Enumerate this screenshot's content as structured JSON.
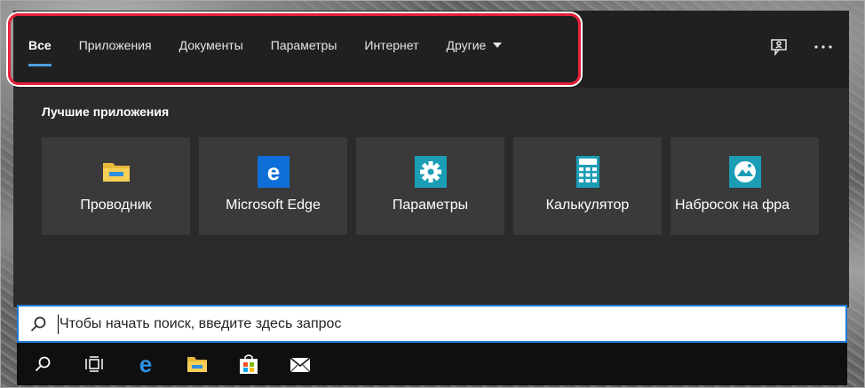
{
  "tabs": [
    {
      "label": "Все",
      "active": true
    },
    {
      "label": "Приложения",
      "active": false
    },
    {
      "label": "Документы",
      "active": false
    },
    {
      "label": "Параметры",
      "active": false
    },
    {
      "label": "Интернет",
      "active": false
    },
    {
      "label": "Другие",
      "active": false,
      "dropdown": true
    }
  ],
  "header_actions": {
    "feedback_icon": "feedback-icon",
    "more_icon": "more-options-icon"
  },
  "best_apps": {
    "title": "Лучшие приложения",
    "items": [
      {
        "label": "Проводник",
        "icon": "file-explorer-icon"
      },
      {
        "label": "Microsoft Edge",
        "icon": "edge-icon"
      },
      {
        "label": "Параметры",
        "icon": "settings-gear-icon"
      },
      {
        "label": "Калькулятор",
        "icon": "calculator-icon"
      },
      {
        "label": "Набросок на фра",
        "icon": "snip-sketch-icon"
      }
    ]
  },
  "search": {
    "placeholder": "Чтобы начать поиск, введите здесь запрос",
    "value": ""
  },
  "taskbar": {
    "items": [
      "search-icon",
      "task-view-icon",
      "edge-icon",
      "file-explorer-icon",
      "store-icon",
      "mail-icon"
    ]
  },
  "colors": {
    "accent": "#4f9fe3",
    "highlight": "#e8203a",
    "panel": "#2b2b2b",
    "header": "#202020",
    "tile": "#3a3a3a",
    "search_border": "#1f7ad1",
    "taskbar": "#0f0f0f"
  }
}
